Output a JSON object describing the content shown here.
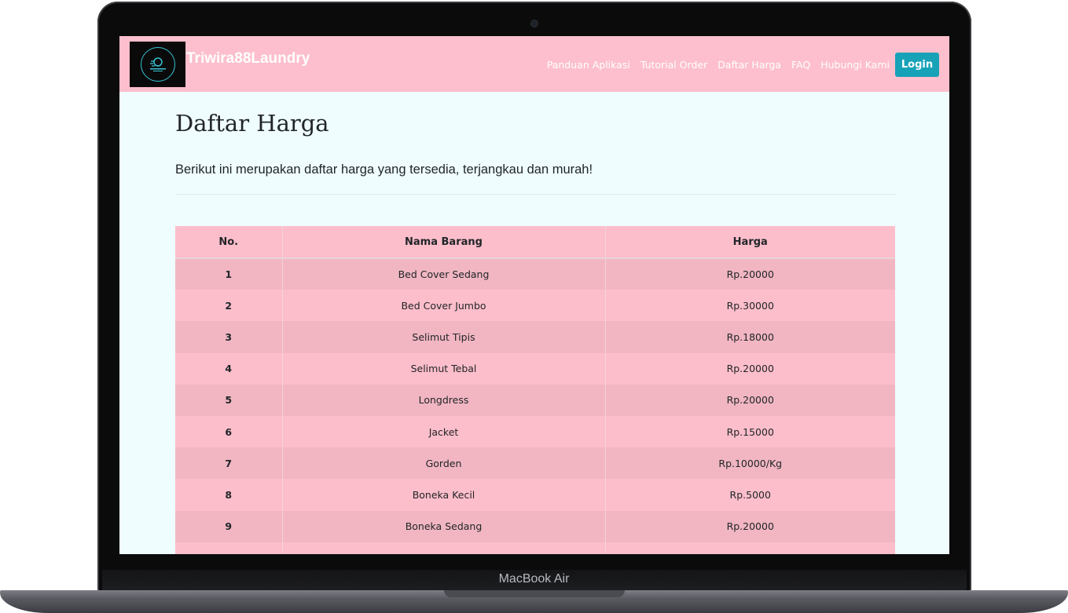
{
  "device": {
    "label": "MacBook Air"
  },
  "navbar": {
    "brand": "Triwira88Laundry",
    "links": [
      "Panduan Aplikasi",
      "Tutorial Order",
      "Daftar Harga",
      "FAQ",
      "Hubungi Kami"
    ],
    "login_label": "Login"
  },
  "page": {
    "title": "Daftar Harga",
    "description": "Berikut ini merupakan daftar harga yang tersedia, terjangkau dan murah!"
  },
  "table": {
    "headers": [
      "No.",
      "Nama Barang",
      "Harga"
    ],
    "rows": [
      [
        "1",
        "Bed Cover Sedang",
        "Rp.20000"
      ],
      [
        "2",
        "Bed Cover Jumbo",
        "Rp.30000"
      ],
      [
        "3",
        "Selimut Tipis",
        "Rp.18000"
      ],
      [
        "4",
        "Selimut Tebal",
        "Rp.20000"
      ],
      [
        "5",
        "Longdress",
        "Rp.20000"
      ],
      [
        "6",
        "Jacket",
        "Rp.15000"
      ],
      [
        "7",
        "Gorden",
        "Rp.10000/Kg"
      ],
      [
        "8",
        "Boneka Kecil",
        "Rp.5000"
      ],
      [
        "9",
        "Boneka Sedang",
        "Rp.20000"
      ]
    ]
  },
  "colors": {
    "navbar_bg": "#fdbfcd",
    "page_bg": "#effdff",
    "accent": "#17a2b8",
    "row_odd": "#f1b6c2",
    "row_even": "#fdbecb"
  }
}
